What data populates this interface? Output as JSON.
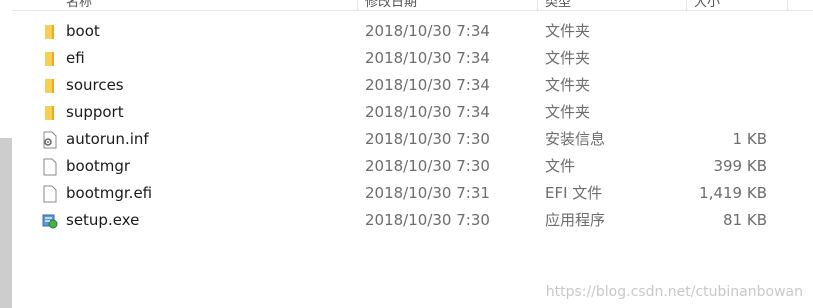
{
  "header": {
    "columns": [
      "名称",
      "修改日期",
      "类型",
      "大小"
    ]
  },
  "files": [
    {
      "name": "boot",
      "date": "2018/10/30 7:34",
      "type": "文件夹",
      "size": "",
      "icon": "folder-icon"
    },
    {
      "name": "efi",
      "date": "2018/10/30 7:34",
      "type": "文件夹",
      "size": "",
      "icon": "folder-icon"
    },
    {
      "name": "sources",
      "date": "2018/10/30 7:34",
      "type": "文件夹",
      "size": "",
      "icon": "folder-icon"
    },
    {
      "name": "support",
      "date": "2018/10/30 7:34",
      "type": "文件夹",
      "size": "",
      "icon": "folder-icon"
    },
    {
      "name": "autorun.inf",
      "date": "2018/10/30 7:30",
      "type": "安装信息",
      "size": "1 KB",
      "icon": "settings-file-icon"
    },
    {
      "name": "bootmgr",
      "date": "2018/10/30 7:30",
      "type": "文件",
      "size": "399 KB",
      "icon": "file-icon"
    },
    {
      "name": "bootmgr.efi",
      "date": "2018/10/30 7:31",
      "type": "EFI 文件",
      "size": "1,419 KB",
      "icon": "file-icon"
    },
    {
      "name": "setup.exe",
      "date": "2018/10/30 7:30",
      "type": "应用程序",
      "size": "81 KB",
      "icon": "setup-app-icon"
    }
  ],
  "watermark": "https://blog.csdn.net/ctubinanbowan",
  "colors": {
    "folder": "#f4c342",
    "text_primary": "#1a1a1a",
    "text_secondary": "#6d6d6d",
    "scrollbar": "#cdcdcd"
  }
}
